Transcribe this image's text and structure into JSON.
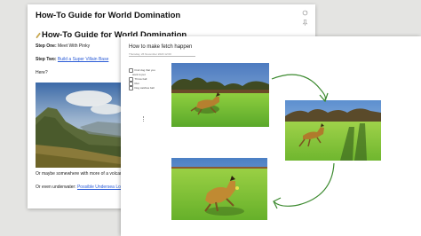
{
  "doc1": {
    "title": "How-To Guide for World Domination",
    "heading": "How-To Guide for World Domination",
    "step_one_label": "Step One:",
    "step_one_text": " Meet With Pinky",
    "step_two_label": "Step Two:",
    "step_two_link": "Build a Super Villain Base",
    "here_text": "Here?",
    "volcanic_text": "Or maybe somewhere with more of a volcanic f",
    "underwater_text": "Or even underwater: ",
    "underwater_link": "Possible Undersea Locati"
  },
  "doc2": {
    "title": "How to make fetch happen",
    "date": "Thursday, 26 November 2020    12:00",
    "checklist": [
      "Find dog that you",
      "want to pet",
      "Throw ball",
      "Run",
      "Dog catches ball"
    ]
  },
  "colors": {
    "arrow": "#3c8a2f",
    "link": "#2a5bd7",
    "grass": "#7fbf3a",
    "sky": "#3c6aa8"
  },
  "icons": [
    "pencil-icon",
    "sync-icon",
    "pin-icon",
    "checkbox-icon",
    "drag-handle-icon",
    "arrow-icon"
  ]
}
